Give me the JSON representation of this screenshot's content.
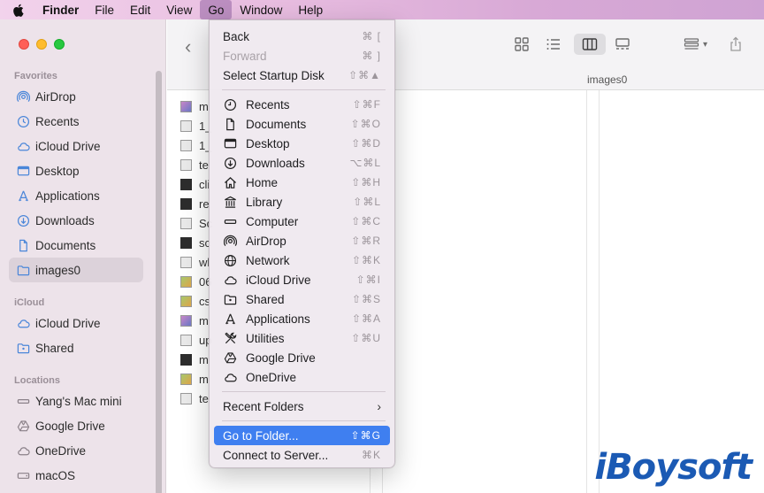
{
  "menubar": {
    "apple": "",
    "app": "Finder",
    "items": [
      "File",
      "Edit",
      "View",
      "Go",
      "Window",
      "Help"
    ]
  },
  "sidebar": {
    "favorites_header": "Favorites",
    "favorites": [
      "AirDrop",
      "Recents",
      "iCloud Drive",
      "Desktop",
      "Applications",
      "Downloads",
      "Documents",
      "images0"
    ],
    "selected": "images0",
    "icloud_header": "iCloud",
    "icloud": [
      "iCloud Drive",
      "Shared"
    ],
    "locations_header": "Locations",
    "locations": [
      "Yang's Mac mini",
      "Google Drive",
      "OneDrive",
      "macOS"
    ]
  },
  "toolbar": {
    "column_title": "images0",
    "active_view": "columns"
  },
  "files": [
    "m",
    "1_",
    "1_",
    "te",
    "cli",
    "re",
    "Sc",
    "sc",
    "wl",
    "06",
    "cs",
    "m",
    "up",
    "m",
    "m",
    "te"
  ],
  "go_menu": {
    "top": [
      {
        "label": "Back",
        "shortcut": "⌘ [",
        "disabled": false
      },
      {
        "label": "Forward",
        "shortcut": "⌘ ]",
        "disabled": true
      },
      {
        "label": "Select Startup Disk",
        "shortcut": "⇧⌘▲",
        "disabled": false
      }
    ],
    "places": [
      {
        "label": "Recents",
        "shortcut": "⇧⌘F",
        "icon": "clock-icon"
      },
      {
        "label": "Documents",
        "shortcut": "⇧⌘O",
        "icon": "document-icon"
      },
      {
        "label": "Desktop",
        "shortcut": "⇧⌘D",
        "icon": "desktop-icon"
      },
      {
        "label": "Downloads",
        "shortcut": "⌥⌘L",
        "icon": "download-icon"
      },
      {
        "label": "Home",
        "shortcut": "⇧⌘H",
        "icon": "home-icon"
      },
      {
        "label": "Library",
        "shortcut": "⇧⌘L",
        "icon": "library-icon"
      },
      {
        "label": "Computer",
        "shortcut": "⇧⌘C",
        "icon": "computer-icon"
      },
      {
        "label": "AirDrop",
        "shortcut": "⇧⌘R",
        "icon": "airdrop-icon"
      },
      {
        "label": "Network",
        "shortcut": "⇧⌘K",
        "icon": "globe-icon"
      },
      {
        "label": "iCloud Drive",
        "shortcut": "⇧⌘I",
        "icon": "cloud-icon"
      },
      {
        "label": "Shared",
        "shortcut": "⇧⌘S",
        "icon": "shared-folder-icon"
      },
      {
        "label": "Applications",
        "shortcut": "⇧⌘A",
        "icon": "applications-icon"
      },
      {
        "label": "Utilities",
        "shortcut": "⇧⌘U",
        "icon": "utilities-icon"
      },
      {
        "label": "Google Drive",
        "shortcut": "",
        "icon": "google-drive-icon"
      },
      {
        "label": "OneDrive",
        "shortcut": "",
        "icon": "cloud-icon"
      }
    ],
    "recent_folders": "Recent Folders",
    "go_to_folder": {
      "label": "Go to Folder...",
      "shortcut": "⇧⌘G"
    },
    "connect_to_server": {
      "label": "Connect to Server...",
      "shortcut": "⌘K"
    }
  },
  "watermark": "iBoysoft",
  "colors": {
    "menu_highlight": "#3f7ff0",
    "menubar_gradient_start": "#f2d3ec",
    "menubar_gradient_end": "#cfa3d3"
  }
}
